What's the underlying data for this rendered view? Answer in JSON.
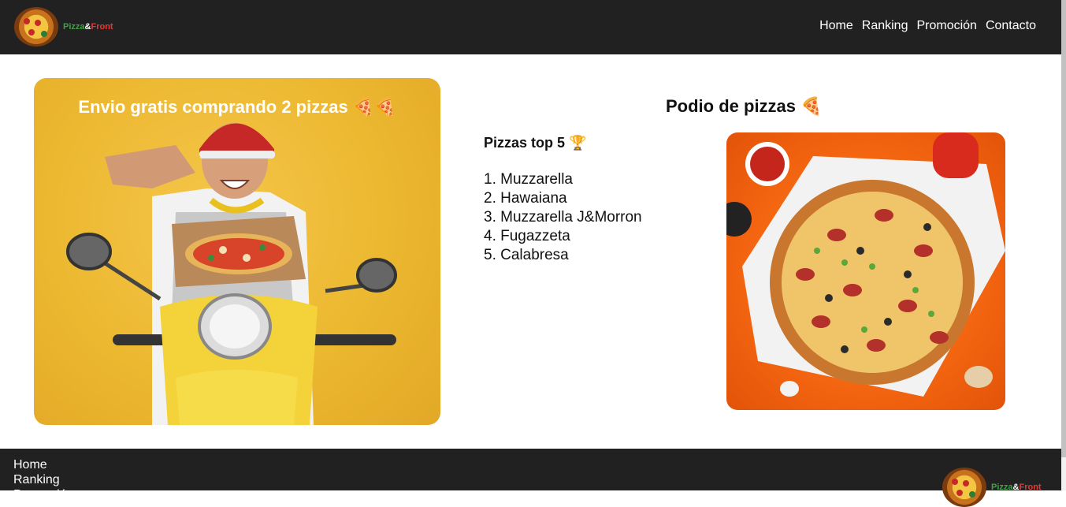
{
  "brand": {
    "part1": "Pizza",
    "part2": "&",
    "part3": "Front"
  },
  "nav": {
    "home": "Home",
    "ranking": "Ranking",
    "promo": "Promoción",
    "contact": "Contacto"
  },
  "promo": {
    "title": "Envio gratis comprando 2 pizzas 🍕🍕"
  },
  "podium": {
    "title": "Podio de pizzas 🍕",
    "top_title": "Pizzas top 5 🏆",
    "items": [
      "1. Muzzarella",
      "2. Hawaiana",
      "3. Muzzarella J&Morron",
      "4. Fugazzeta",
      "5. Calabresa"
    ]
  },
  "footer": {
    "home": "Home",
    "ranking": "Ranking",
    "promo": "Promoción"
  },
  "colors": {
    "header_bg": "#212121",
    "brand_green": "#43a047",
    "brand_red": "#e53935",
    "promo_bg": "#ecb830",
    "photo_bg": "#f36510"
  }
}
